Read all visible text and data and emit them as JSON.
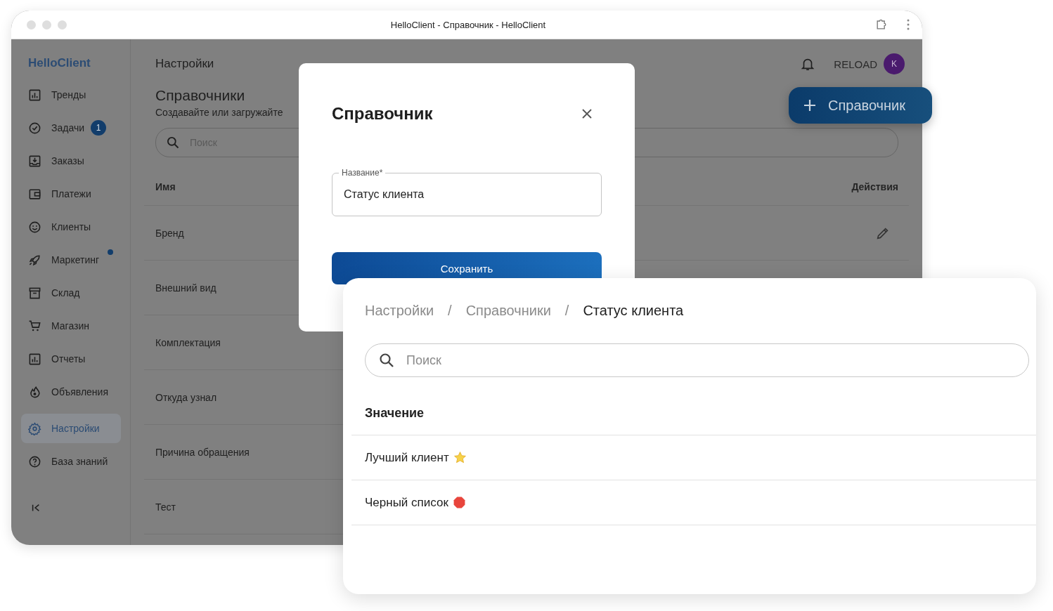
{
  "window": {
    "title": "HelloClient - Справочник - HelloClient"
  },
  "sidebar": {
    "logo": "HelloClient",
    "items": [
      {
        "label": "Тренды",
        "selected": false,
        "dot": false
      },
      {
        "label": "Задачи",
        "selected": false,
        "badge": "1",
        "dot": false
      },
      {
        "label": "Заказы",
        "selected": false,
        "dot": false
      },
      {
        "label": "Платежи",
        "selected": false,
        "dot": false
      },
      {
        "label": "Клиенты",
        "selected": false,
        "dot": false
      },
      {
        "label": "Маркетинг",
        "selected": false,
        "dot": true
      },
      {
        "label": "Склад",
        "selected": false,
        "dot": false
      },
      {
        "label": "Магазин",
        "selected": false,
        "dot": false
      },
      {
        "label": "Отчеты",
        "selected": false,
        "dot": false
      },
      {
        "label": "Объявления",
        "selected": false,
        "dot": false
      },
      {
        "label": "Настройки",
        "selected": true,
        "dot": false
      },
      {
        "label": "База знаний",
        "selected": false,
        "dot": false
      }
    ]
  },
  "header": {
    "title": "Настройки",
    "user": "RELOAD",
    "avatar": "K"
  },
  "page": {
    "title": "Справочники",
    "subtitle": "Создавайте или загружайте",
    "search_placeholder": "Поиск",
    "columns": [
      "Имя",
      "Действия"
    ],
    "rows": [
      "Бренд",
      "Внешний вид",
      "Комплектация",
      "Откуда узнал",
      "Причина обращения",
      "Тест"
    ]
  },
  "add_button": {
    "label": "Справочник"
  },
  "modal": {
    "title": "Справочник",
    "field": {
      "label": "Название*",
      "value": "Статус клиента"
    },
    "save_button": "Сохранить"
  },
  "detail": {
    "breadcrumbs": [
      "Настройки",
      "Справочники",
      "Статус клиента"
    ],
    "separator": "/",
    "search_placeholder": "Поиск",
    "column": "Значение",
    "rows": [
      {
        "label": "Лучший клиент",
        "kind": "star"
      },
      {
        "label": "Черный список",
        "kind": "stop"
      }
    ]
  }
}
